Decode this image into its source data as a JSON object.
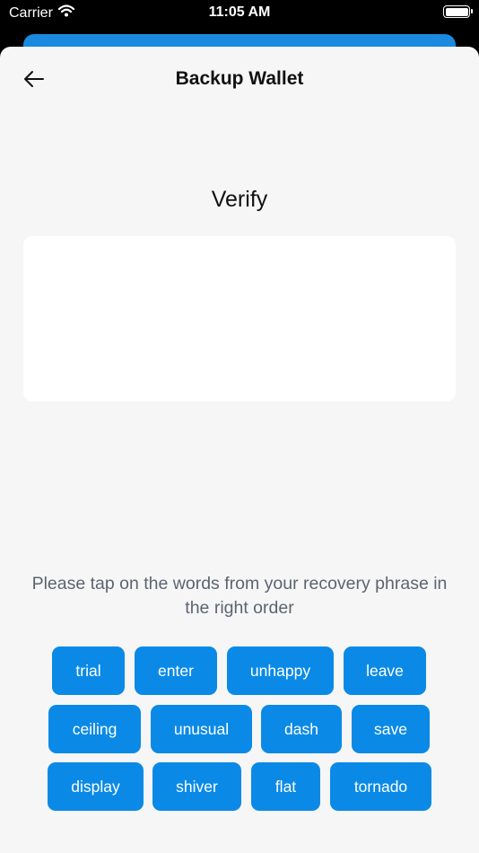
{
  "status_bar": {
    "carrier": "Carrier",
    "time": "11:05 AM"
  },
  "header": {
    "title": "Backup Wallet"
  },
  "main": {
    "section_title": "Verify",
    "instructions": "Please tap on the words from your recovery phrase in the right order"
  },
  "words": {
    "row1": [
      "trial",
      "enter",
      "unhappy",
      "leave"
    ],
    "row2": [
      "ceiling",
      "unusual",
      "dash",
      "save"
    ],
    "row3": [
      "display",
      "shiver",
      "flat",
      "tornado"
    ]
  },
  "colors": {
    "accent": "#0a8ae6",
    "sheet_bg": "#f6f6f6"
  }
}
